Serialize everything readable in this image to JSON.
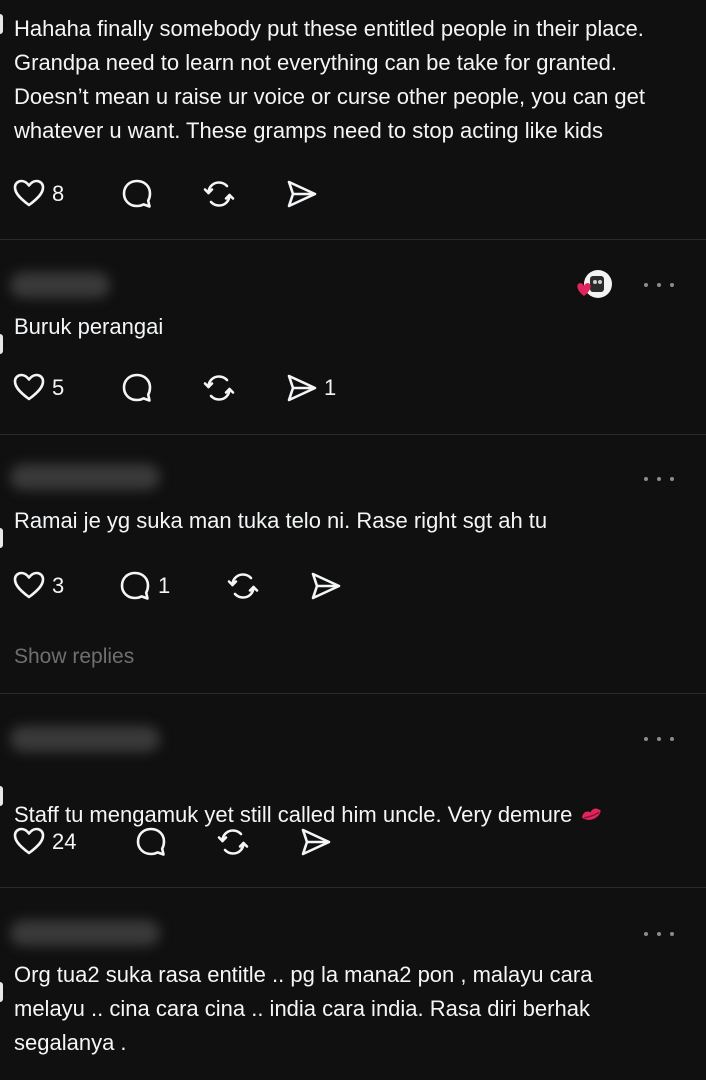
{
  "posts": [
    {
      "text": "Hahaha finally somebody put these entitled people in their place.\nGrandpa need to learn not everything can be take for granted.\nDoesn’t mean u raise ur voice or curse other people, you can get\nwhatever u want. These gramps need to stop acting like kids",
      "likes": "8",
      "replies": "",
      "reposts": "",
      "shares": ""
    },
    {
      "text": "Buruk perangai",
      "likes": "5",
      "replies": "",
      "reposts": "",
      "shares": "1"
    },
    {
      "text": "Ramai je yg suka man tuka telo ni. Rase right sgt ah tu",
      "likes": "3",
      "replies": "1",
      "reposts": "",
      "shares": "",
      "show_replies": "Show replies"
    },
    {
      "text": "Staff tu mengamuk yet still called him uncle. Very demure",
      "likes": "24",
      "replies": "",
      "reposts": "",
      "shares": ""
    },
    {
      "text": "Org tua2 suka rasa entitle .. pg la mana2 pon , malayu cara\nmelayu .. cina cara cina .. india cara india. Rasa diri berhak\nsegalanya ."
    }
  ],
  "icons": {
    "like": "heart-icon",
    "reply": "reply-bubble-icon",
    "repost": "repost-icon",
    "share": "share-send-icon",
    "more": "more-dots-icon",
    "emoji": "kiss-lips-emoji"
  },
  "colors": {
    "background": "#101010",
    "text": "#f3f5f7",
    "muted": "#6f6f6f",
    "divider": "#2a2a2a",
    "emoji_red": "#e0245e"
  }
}
